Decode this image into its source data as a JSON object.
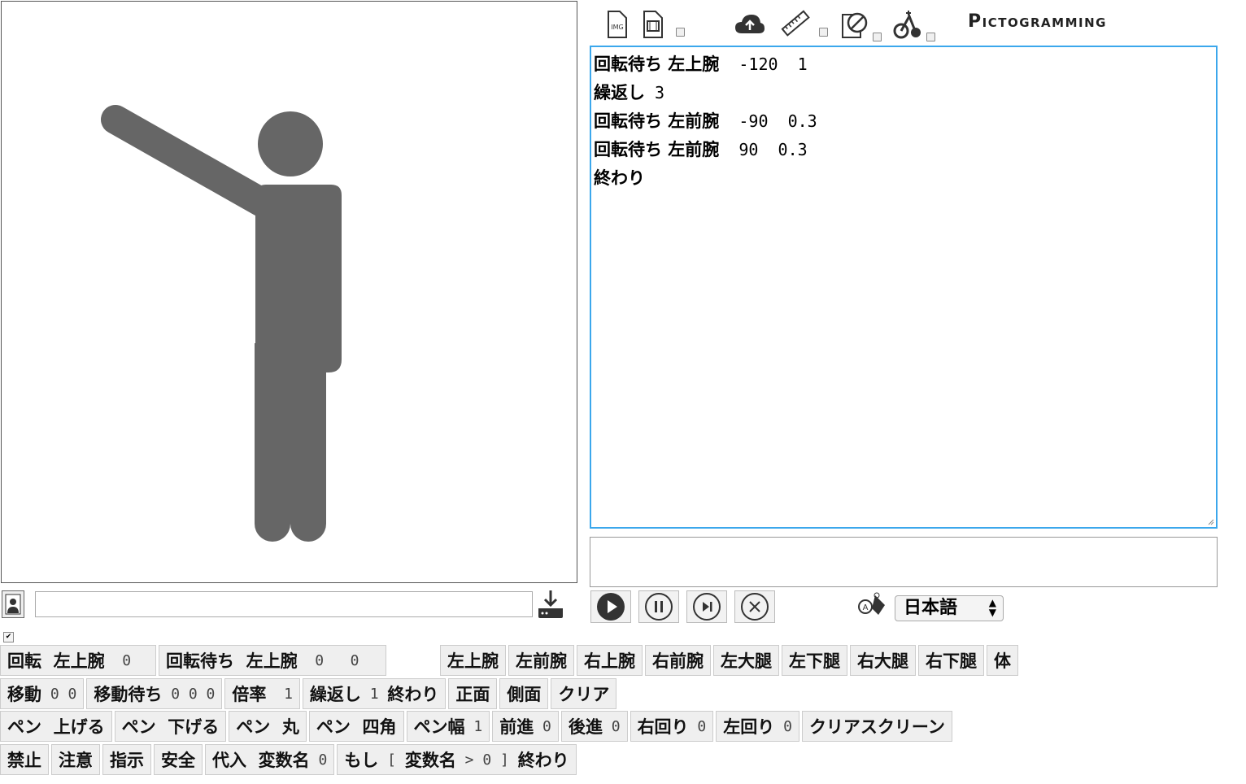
{
  "app": {
    "brand": "Pictogramming"
  },
  "toolbar": {
    "icons": [
      "image-export-icon",
      "video-export-icon",
      "cloud-upload-icon",
      "ruler-icon",
      "no-edit-icon",
      "scooter-icon"
    ]
  },
  "editor": {
    "lines": [
      {
        "kw": "回転待ち 左上腕",
        "args": "  -120  1"
      },
      {
        "kw": "繰返し",
        "args": " 3"
      },
      {
        "kw": "回転待ち 左前腕",
        "args": "  -90  0.3"
      },
      {
        "kw": "回転待ち 左前腕",
        "args": "  90  0.3"
      },
      {
        "kw": "終わり",
        "args": ""
      }
    ]
  },
  "output": {
    "text": ""
  },
  "name_input": {
    "value": ""
  },
  "language": {
    "selected": "日本語"
  },
  "palette": {
    "row1": [
      {
        "label": "回転  左上腕",
        "nums": "  0"
      },
      {
        "label": "回転待ち  左上腕",
        "nums": "  0   0"
      },
      {
        "label": "左上腕",
        "nums": ""
      },
      {
        "label": "左前腕",
        "nums": ""
      },
      {
        "label": "右上腕",
        "nums": ""
      },
      {
        "label": "右前腕",
        "nums": ""
      },
      {
        "label": "左大腿",
        "nums": ""
      },
      {
        "label": "左下腿",
        "nums": ""
      },
      {
        "label": "右大腿",
        "nums": ""
      },
      {
        "label": "右下腿",
        "nums": ""
      },
      {
        "label": "体",
        "nums": ""
      }
    ],
    "row2": [
      {
        "label": "移動",
        "nums": " 0 0"
      },
      {
        "label": "移動待ち",
        "nums": " 0 0 0"
      },
      {
        "label": "倍率",
        "nums": "  1"
      },
      {
        "label": "繰返し",
        "nums": " 1 ",
        "tail": "終わり"
      },
      {
        "label": "正面",
        "nums": ""
      },
      {
        "label": "側面",
        "nums": ""
      },
      {
        "label": "クリア",
        "nums": ""
      }
    ],
    "row3": [
      {
        "label": "ペン  上げる",
        "nums": ""
      },
      {
        "label": "ペン  下げる",
        "nums": ""
      },
      {
        "label": "ペン  丸",
        "nums": ""
      },
      {
        "label": "ペン  四角",
        "nums": ""
      },
      {
        "label": "ペン幅",
        "nums": " 1"
      },
      {
        "label": "前進",
        "nums": " 0"
      },
      {
        "label": "後進",
        "nums": " 0"
      },
      {
        "label": "右回り",
        "nums": " 0"
      },
      {
        "label": "左回り",
        "nums": " 0"
      },
      {
        "label": "クリアスクリーン",
        "nums": ""
      }
    ],
    "row4": [
      {
        "label": "禁止",
        "nums": ""
      },
      {
        "label": "注意",
        "nums": ""
      },
      {
        "label": "指示",
        "nums": ""
      },
      {
        "label": "安全",
        "nums": ""
      },
      {
        "label": "代入  変数名",
        "nums": " 0"
      },
      {
        "label": "もし",
        "nums": " [ ",
        "mid": "変数名",
        "nums2": " > 0 ] ",
        "tail": "終わり"
      }
    ]
  },
  "colors": {
    "figure": "#666666",
    "editor_border": "#3ba7ec"
  }
}
